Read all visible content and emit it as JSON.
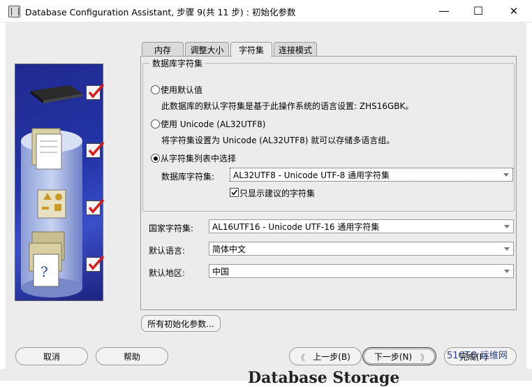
{
  "window": {
    "title": "Database Configuration Assistant, 步骤 9(共 11 步) : 初始化参数",
    "minimize": "—",
    "maximize": "☐",
    "close": "✕"
  },
  "tabs": [
    {
      "label": "内存",
      "active": false
    },
    {
      "label": "调整大小",
      "active": false
    },
    {
      "label": "字符集",
      "active": true
    },
    {
      "label": "连接模式",
      "active": false
    }
  ],
  "charset_group": {
    "title": "数据库字符集",
    "option_default": {
      "label": "使用默认值",
      "desc": "此数据库的默认字符集是基于此操作系统的语言设置: ZHS16GBK。",
      "selected": false
    },
    "option_unicode": {
      "label": "使用 Unicode (AL32UTF8)",
      "desc": "将字符集设置为 Unicode (AL32UTF8) 就可以存储多语言组。",
      "selected": false
    },
    "option_list": {
      "label": "从字符集列表中选择",
      "selected": true
    },
    "db_charset_label": "数据库字符集:",
    "db_charset_value": "AL32UTF8 - Unicode UTF-8 通用字符集",
    "show_recommended_label": "只显示建议的字符集",
    "show_recommended_checked": true
  },
  "national_charset": {
    "label": "国家字符集:",
    "value": "AL16UTF16 - Unicode UTF-16 通用字符集"
  },
  "default_language": {
    "label": "默认语言:",
    "value": "简体中文"
  },
  "default_territory": {
    "label": "默认地区:",
    "value": "中国"
  },
  "all_params_button": "所有初始化参数...",
  "buttons": {
    "cancel": "取消",
    "help": "帮助",
    "back": "上一步(B)",
    "next": "下一步(N)",
    "finish": "完成(F)"
  },
  "background_heading": "Database Storage",
  "watermark": "51CTO 运维网",
  "colors": {
    "accent_check": "#d81c1c",
    "panel_blue": "#2434a8",
    "window_bg": "#ececec"
  }
}
